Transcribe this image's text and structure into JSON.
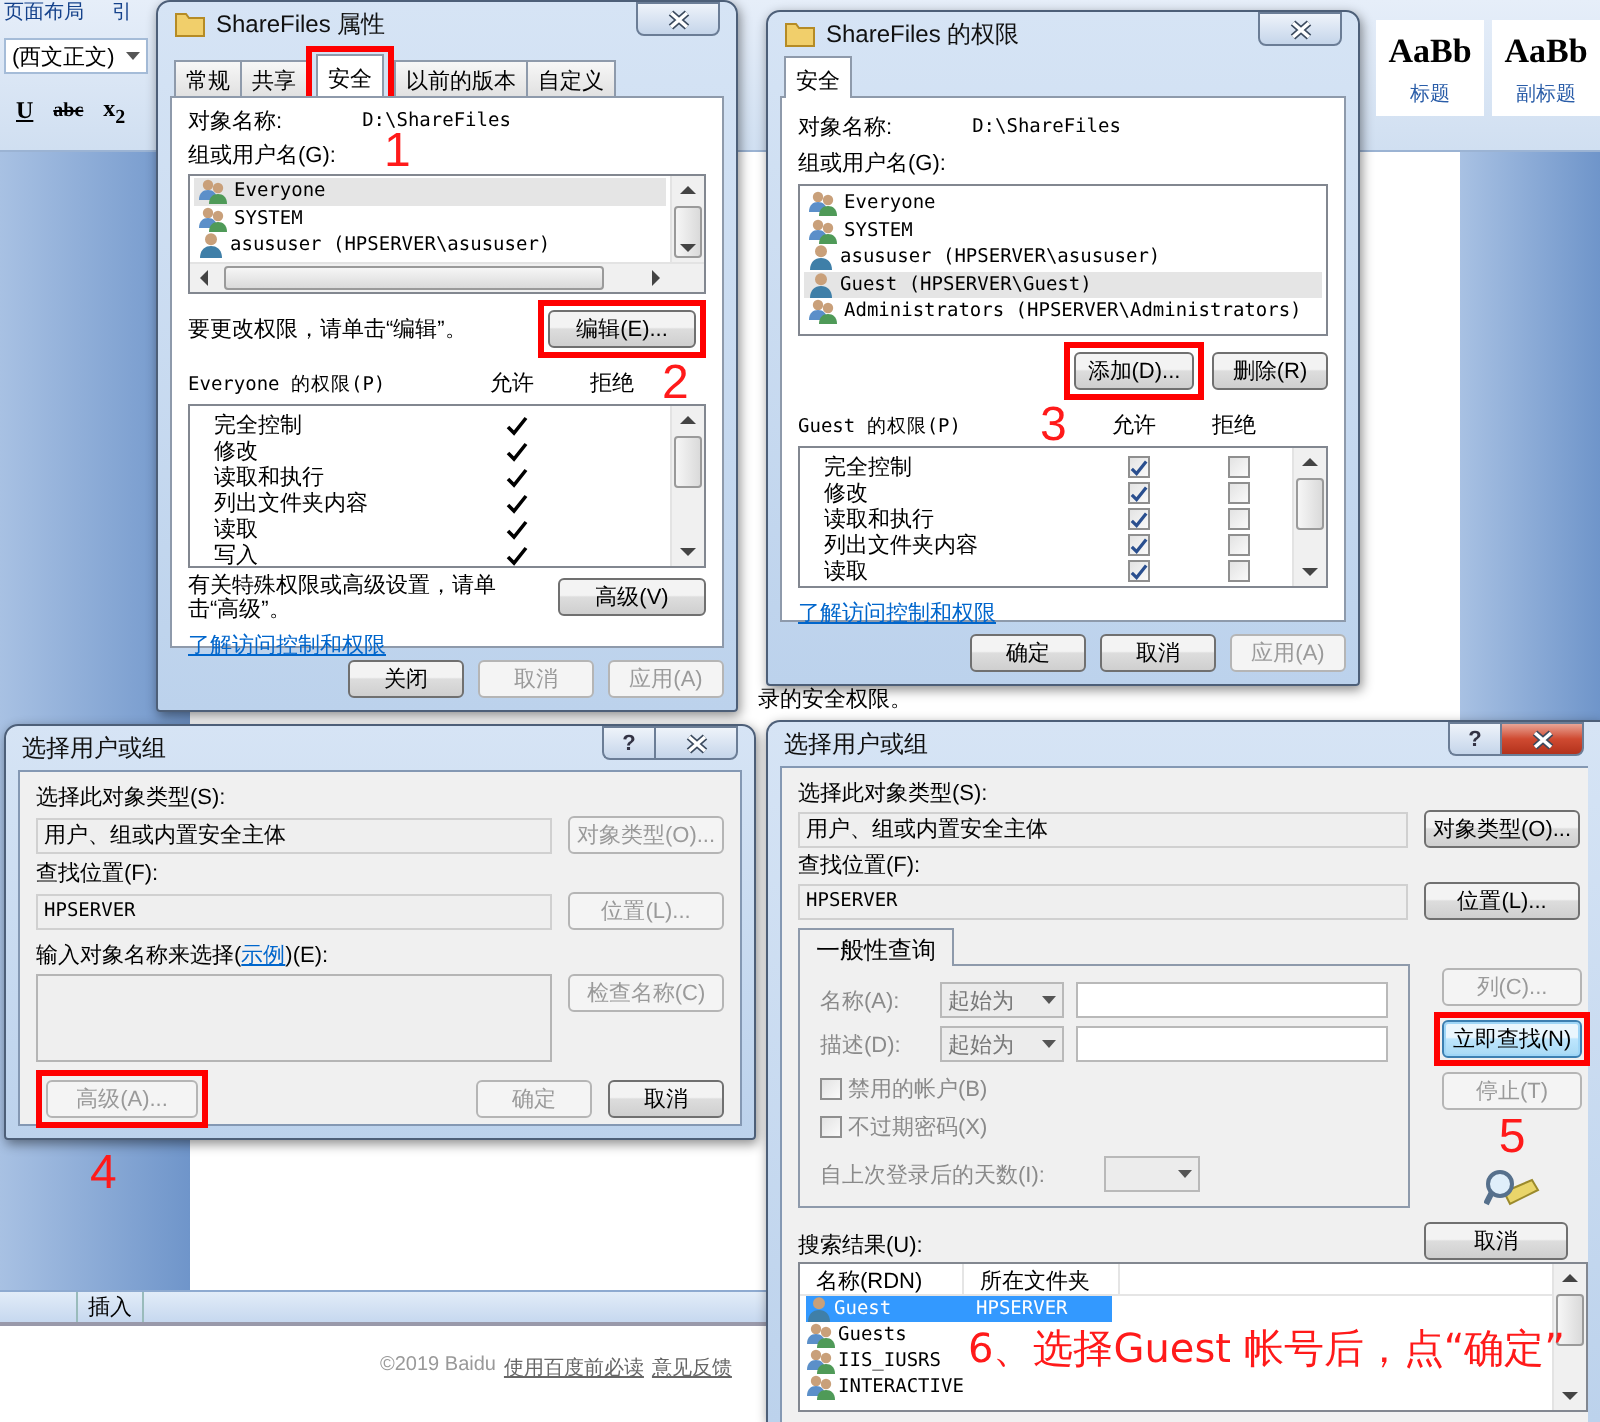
{
  "word": {
    "ribbon_tabs": [
      "页面布局",
      "引"
    ],
    "font_name": "(西文正文)",
    "format_buttons": [
      {
        "label": "U",
        "kind": "underline"
      },
      {
        "label": "abc",
        "kind": "strikethrough"
      },
      {
        "label": "x$_{2}$",
        "kind": "subscript"
      }
    ],
    "styles": [
      {
        "preview": "AaBb",
        "name": "标题"
      },
      {
        "preview": "AaBb",
        "name": "副标题"
      }
    ],
    "document_text": "录的安全权限。",
    "status_tabs": [
      "插入"
    ]
  },
  "footer": {
    "copyright": "©2019 Baidu",
    "links": [
      "使用百度前必读",
      "意见反馈"
    ]
  },
  "properties_dialog": {
    "title": "ShareFiles 属性",
    "active": false,
    "tabs": [
      {
        "label": "常规",
        "selected": false
      },
      {
        "label": "共享",
        "selected": false
      },
      {
        "label": "安全",
        "selected": true
      },
      {
        "label": "以前的版本",
        "selected": false
      },
      {
        "label": "自定义",
        "selected": false
      }
    ],
    "object_label": "对象名称:",
    "object_value": "D:\\ShareFiles",
    "groups_label": "组或用户名(G):",
    "users": [
      {
        "name": "Everyone",
        "kind": "group",
        "selected": true
      },
      {
        "name": "SYSTEM",
        "kind": "group",
        "selected": false
      },
      {
        "name": "asususer (HPSERVER\\asususer)",
        "kind": "user",
        "selected": false
      }
    ],
    "edit_hint": "要更改权限，请单击“编辑”。",
    "edit_button": "编辑(E)...",
    "permissions_label": "Everyone 的权限(P)",
    "allow_label": "允许",
    "deny_label": "拒绝",
    "permissions": [
      {
        "name": "完全控制",
        "allow": true,
        "deny": false
      },
      {
        "name": "修改",
        "allow": true,
        "deny": false
      },
      {
        "name": "读取和执行",
        "allow": true,
        "deny": false
      },
      {
        "name": "列出文件夹内容",
        "allow": true,
        "deny": false
      },
      {
        "name": "读取",
        "allow": true,
        "deny": false
      },
      {
        "name": "写入",
        "allow": true,
        "deny": false
      }
    ],
    "advanced_hint": "有关特殊权限或高级设置，请单击“高级”。",
    "advanced_button": "高级(V)",
    "link": "了解访问控制和权限",
    "buttons": [
      {
        "label": "关闭",
        "disabled": false
      },
      {
        "label": "取消",
        "disabled": true
      },
      {
        "label": "应用(A)",
        "disabled": true
      }
    ]
  },
  "permissions_dialog": {
    "title": "ShareFiles 的权限",
    "active": false,
    "tabs": [
      {
        "label": "安全",
        "selected": true
      }
    ],
    "object_label": "对象名称:",
    "object_value": "D:\\ShareFiles",
    "groups_label": "组或用户名(G):",
    "users": [
      {
        "name": "Everyone",
        "kind": "group",
        "selected": false
      },
      {
        "name": "SYSTEM",
        "kind": "group",
        "selected": false
      },
      {
        "name": "asususer (HPSERVER\\asususer)",
        "kind": "user",
        "selected": false
      },
      {
        "name": "Guest (HPSERVER\\Guest)",
        "kind": "user",
        "selected": true
      },
      {
        "name": "Administrators (HPSERVER\\Administrators)",
        "kind": "group",
        "selected": false
      }
    ],
    "add_button": "添加(D)...",
    "remove_button": "删除(R)",
    "permissions_label": "Guest 的权限(P)",
    "allow_label": "允许",
    "deny_label": "拒绝",
    "permissions": [
      {
        "name": "完全控制",
        "allow": true,
        "deny": false
      },
      {
        "name": "修改",
        "allow": true,
        "deny": false
      },
      {
        "name": "读取和执行",
        "allow": true,
        "deny": false
      },
      {
        "name": "列出文件夹内容",
        "allow": true,
        "deny": false
      },
      {
        "name": "读取",
        "allow": true,
        "deny": false
      }
    ],
    "link": "了解访问控制和权限",
    "buttons": [
      {
        "label": "确定",
        "disabled": false
      },
      {
        "label": "取消",
        "disabled": false
      },
      {
        "label": "应用(A)",
        "disabled": true
      }
    ]
  },
  "select_dialog": {
    "title": "选择用户或组",
    "active": false,
    "help_button": "?",
    "object_type_label": "选择此对象类型(S):",
    "object_type_value": "用户、组或内置安全主体",
    "object_type_button": {
      "label": "对象类型(O)...",
      "disabled": true
    },
    "location_label": "查找位置(F):",
    "location_value": "HPSERVER",
    "location_button": {
      "label": "位置(L)...",
      "disabled": true
    },
    "enter_label_before": "输入对象名称来选择(",
    "enter_link": "示例",
    "enter_label_after": ")(E):",
    "check_button": {
      "label": "检查名称(C)",
      "disabled": true
    },
    "advanced_button": {
      "label": "高级(A)...",
      "disabled": true
    },
    "buttons": [
      {
        "label": "确定",
        "disabled": true
      },
      {
        "label": "取消",
        "disabled": false
      }
    ]
  },
  "search_dialog": {
    "title": "选择用户或组",
    "active": true,
    "help_button": "?",
    "object_type_label": "选择此对象类型(S):",
    "object_type_value": "用户、组或内置安全主体",
    "object_type_button": {
      "label": "对象类型(O)...",
      "disabled": false
    },
    "location_label": "查找位置(F):",
    "location_value": "HPSERVER",
    "location_button": {
      "label": "位置(L)...",
      "disabled": false
    },
    "query_tab": "一般性查询",
    "query_fields": [
      {
        "label": "名称(A):",
        "mode": "起始为"
      },
      {
        "label": "描述(D):",
        "mode": "起始为"
      }
    ],
    "query_checks": [
      {
        "label": "禁用的帐户(B)",
        "checked": false
      },
      {
        "label": "不过期密码(X)",
        "checked": false
      }
    ],
    "days_label": "自上次登录后的天数(I):",
    "side_buttons": [
      {
        "label": "列(C)...",
        "disabled": true,
        "default": false
      },
      {
        "label": "立即查找(N)",
        "disabled": false,
        "default": true
      },
      {
        "label": "停止(T)",
        "disabled": true,
        "default": false
      }
    ],
    "cancel_button": "取消",
    "results_label": "搜索结果(U):",
    "results_columns": [
      "名称(RDN)",
      "所在文件夹"
    ],
    "results": [
      {
        "name": "Guest",
        "folder": "HPSERVER",
        "kind": "user",
        "selected": true
      },
      {
        "name": "Guests",
        "kind": "group",
        "selected": false
      },
      {
        "name": "IIS_IUSRS",
        "kind": "group",
        "selected": false
      },
      {
        "name": "INTERACTIVE",
        "kind": "group",
        "selected": false
      }
    ]
  },
  "annotations": {
    "steps": [
      "1",
      "2",
      "3",
      "4",
      "5"
    ],
    "caption": "6、选择Guest 帐号后，点“确定”"
  }
}
